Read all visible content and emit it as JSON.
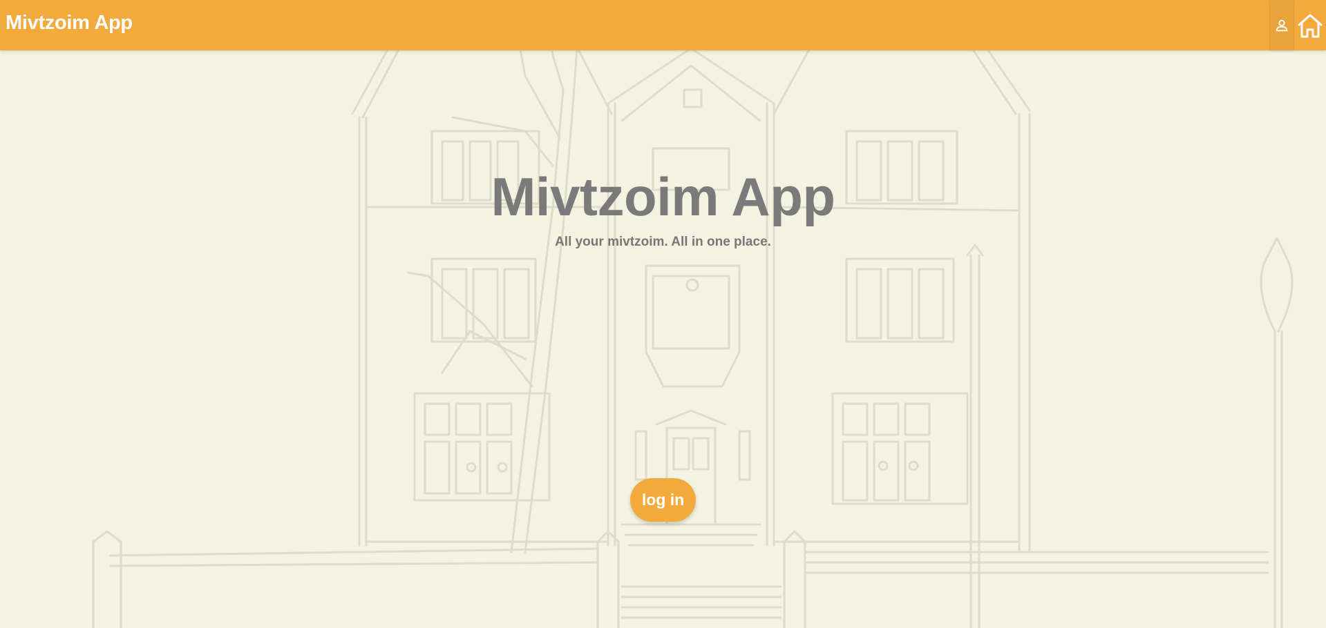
{
  "header": {
    "brand": "Mivtzoim App",
    "user_icon": "person-icon",
    "home_icon": "home-icon",
    "background_color": "#f2aa3d"
  },
  "hero": {
    "title": "Mivtzoim App",
    "subtitle": "All your mivtzoim. All in one place.",
    "login_label": "log in",
    "background_illustration": "building-sketch"
  },
  "colors": {
    "accent": "#f2aa3d",
    "page_background": "#f4f3e1",
    "title_text": "#7a7a7a"
  }
}
